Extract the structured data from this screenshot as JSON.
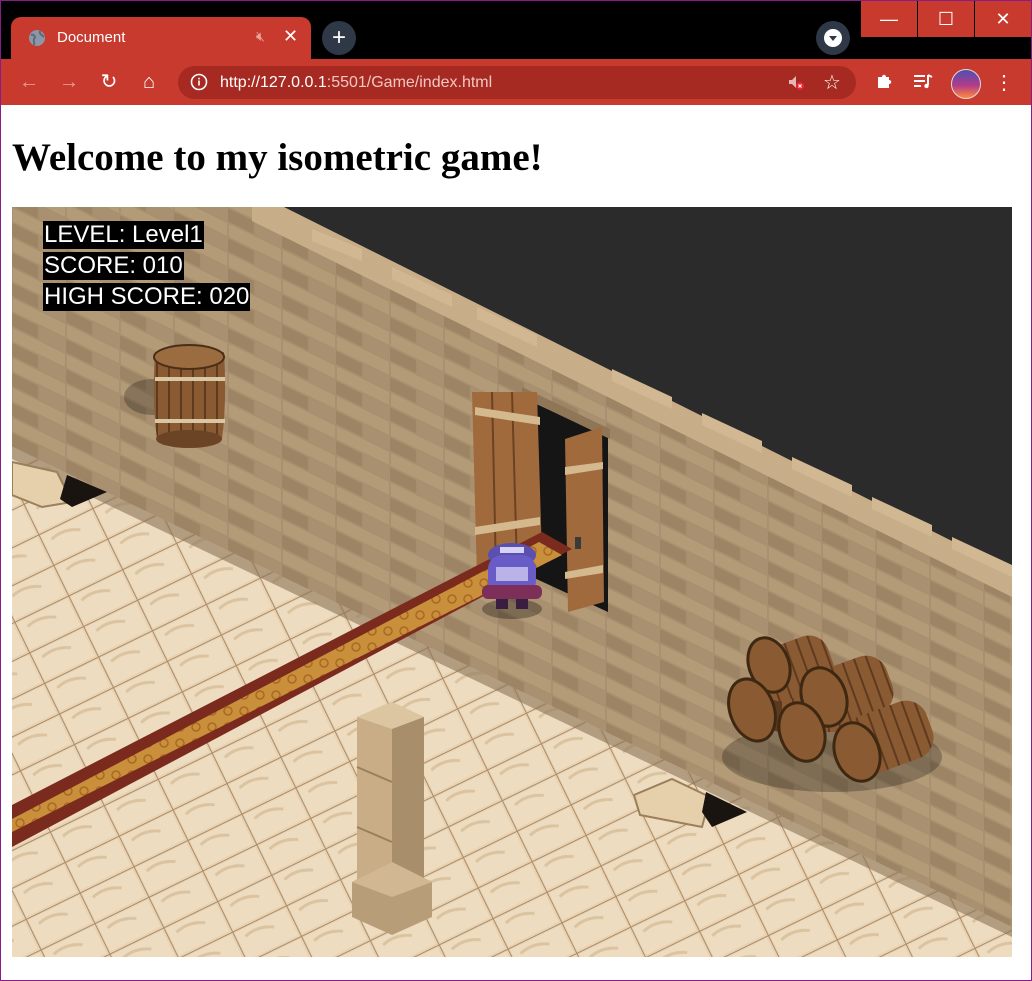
{
  "browser": {
    "tab_title": "Document",
    "url_host": "http://127.0.0.1",
    "url_rest": ":5501/Game/index.html",
    "accent": "#c8392e"
  },
  "page": {
    "heading": "Welcome to my isometric game!"
  },
  "hud": {
    "level_text": "LEVEL: Level1",
    "score_text": "SCORE: 010",
    "high_score_text": "HIGH SCORE: 020"
  },
  "icons": [
    "globe-icon",
    "mute-icon",
    "close-icon",
    "plus-icon",
    "tab-search-icon",
    "minimize-icon",
    "maximize-icon",
    "window-close-icon",
    "back-icon",
    "forward-icon",
    "reload-icon",
    "home-icon",
    "info-icon",
    "sound-blocked-icon",
    "star-icon",
    "puzzle-icon",
    "media-icon",
    "profile-avatar",
    "more-icon"
  ]
}
